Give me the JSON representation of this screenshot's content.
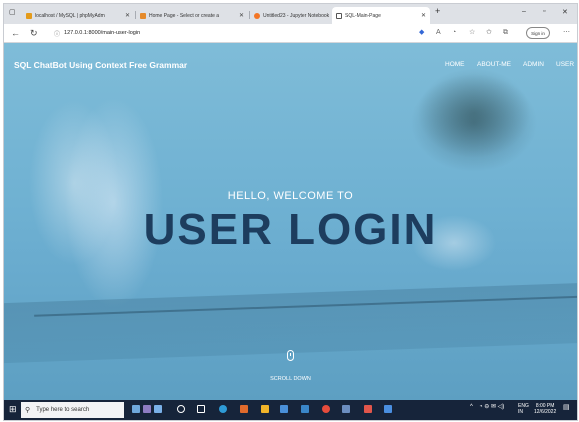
{
  "browser": {
    "tabs": [
      {
        "label": "localhost / MySQL | phpMyAdm",
        "icon": "phpmyadmin-icon",
        "color": "#e49b1a"
      },
      {
        "label": "Home Page - Select or create a",
        "icon": "page-icon",
        "color": "#e58a2a"
      },
      {
        "label": "Untitled23 - Jupyter Notebook",
        "icon": "jupyter-icon",
        "color": "#f37626"
      },
      {
        "label": "SQL-Main-Page",
        "icon": "document-icon",
        "color": "#555555"
      }
    ],
    "address": "127.0.0.1:8000/main-user-login",
    "signin_label": "Sign in"
  },
  "page": {
    "brand": "SQL ChatBot Using Context Free Grammar",
    "nav": [
      "HOME",
      "ABOUT-ME",
      "ADMIN",
      "USER"
    ],
    "greeting": "HELLO, WELCOME TO",
    "headline": "USER LOGIN",
    "scroll_label": "SCROLL DOWN"
  },
  "taskbar": {
    "search_placeholder": "Type here to search",
    "lang_top": "ENG",
    "lang_bottom": "IN",
    "time": "8:00 PM",
    "date": "12/6/2022"
  },
  "colors": {
    "headline": "#1d3d5e",
    "overlay": "#6fb1d2",
    "taskbar": "#16243a"
  }
}
